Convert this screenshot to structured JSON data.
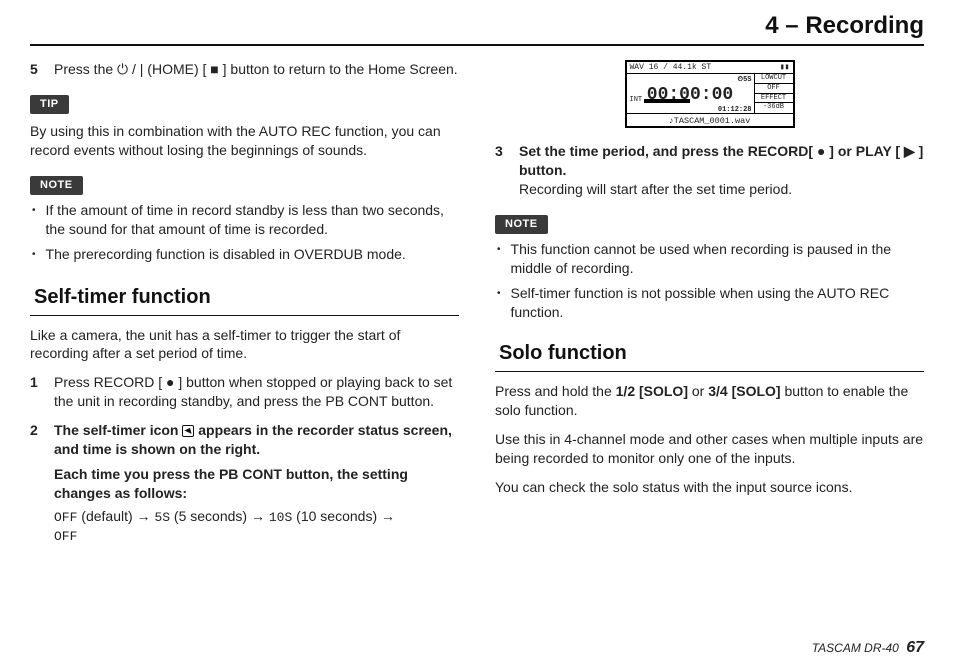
{
  "header": {
    "title": "4 – Recording"
  },
  "col1": {
    "step5": {
      "num": "5",
      "bold": "Press the ⏻ / | (HOME) [ ■ ] button to return to the Home Screen."
    },
    "tip_label": "TIP",
    "tip_text": "By using this in combination with the AUTO REC function, you can record events without losing the beginnings of sounds.",
    "note_label": "NOTE",
    "note_items": [
      "If the amount of time in record standby is less than two seconds, the sound for that amount of time is recorded.",
      "The prerecording function is disabled in OVERDUB mode."
    ],
    "selftimer_heading": "Self-timer function",
    "selftimer_intro": "Like a camera, the unit has a self-timer to trigger the start of recording after a set period of time.",
    "step1": {
      "num": "1",
      "bold": "Press RECORD [ ● ] button when stopped or playing back to set the unit in recording standby, and press the PB CONT button."
    },
    "step2": {
      "num": "2",
      "bold_a": "The self-timer icon ",
      "bold_b": " appears in the recorder status screen, and time is shown on the right.",
      "bold_c": "Each time you press the PB CONT button, the setting changes as follows:",
      "seq": {
        "off1": "OFF",
        "off_hint": " (default)  →  ",
        "s5": "5S",
        "s5_hint": " (5 seconds)  →  ",
        "s10": "10S",
        "s10_hint": " (10 seconds)  →  ",
        "off2": "OFF"
      }
    }
  },
  "col2": {
    "lcd": {
      "top_left": "WAV 16 / 44.1k  ST",
      "top_right": "▮▮",
      "timer_small_left": "⏲5S",
      "time": "00:00:00",
      "clock": "01:12:28",
      "side": [
        "LOWCUT",
        "OFF",
        "EFFECT",
        "-36dB"
      ],
      "int": "INT",
      "file": "♪TASCAM_0001.wav"
    },
    "step3": {
      "num": "3",
      "bold": "Set the time period, and press the RECORD[ ● ] or PLAY [ ▶ ] button.",
      "plain": "Recording will start after the set time period."
    },
    "note_label": "NOTE",
    "note_items": [
      "This function cannot be used when recording is paused in the middle of recording.",
      "Self-timer function is not possible when using the AUTO REC function."
    ],
    "solo_heading": "Solo function",
    "solo_p1a": "Press and hold the ",
    "solo_p1b": "1/2 [SOLO]",
    "solo_p1c": " or ",
    "solo_p1d": "3/4 [SOLO]",
    "solo_p1e": " button to enable the solo function.",
    "solo_p2": "Use this in 4-channel mode and other cases when multiple inputs are being recorded to monitor only one of the inputs.",
    "solo_p3": "You can check the solo status with the input source icons."
  },
  "footer": {
    "model": "TASCAM DR-40",
    "page": "67"
  }
}
